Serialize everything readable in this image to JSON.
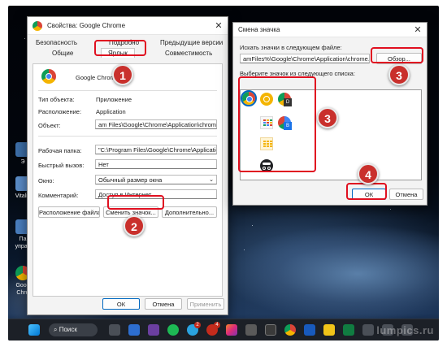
{
  "desktop": {
    "items": [
      {
        "label": "Э"
      },
      {
        "label": "Vitaliy"
      },
      {
        "label": "Па\nуправ"
      },
      {
        "label": "Goog\nChro"
      }
    ]
  },
  "properties": {
    "title": "Свойства: Google Chrome",
    "tabs_row1": [
      "Безопасность",
      "Подробно",
      "Предыдущие версии"
    ],
    "tabs_row2": [
      "Общие",
      "Ярлык",
      "Совместимость"
    ],
    "app_name": "Google Chrome",
    "fields": {
      "type_label": "Тип объекта:",
      "type_value": "Приложение",
      "location_label": "Расположение:",
      "location_value": "Application",
      "target_label": "Объект:",
      "target_value": "am Files\\Google\\Chrome\\Application\\chrome.exe\"",
      "workdir_label": "Рабочая папка:",
      "workdir_value": "\"C:\\Program Files\\Google\\Chrome\\Application\"",
      "hotkey_label": "Быстрый вызов:",
      "hotkey_value": "Нет",
      "window_label": "Окно:",
      "window_value": "Обычный размер окна",
      "comment_label": "Комментарий:",
      "comment_value": "Доступ в Интернет"
    },
    "buttons": {
      "open_location": "Расположение файла",
      "change_icon": "Сменить значок...",
      "advanced": "Дополнительно...",
      "ok": "ОК",
      "cancel": "Отмена",
      "apply": "Применить"
    }
  },
  "icon_dialog": {
    "title": "Смена значка",
    "search_label": "Искать значки в следующем файле:",
    "path_value": "amFiles%\\Google\\Chrome\\Application\\chrome.exe",
    "browse": "Обзор...",
    "list_label": "Выберите значок из следующего списка:",
    "ok": "ОК",
    "cancel": "Отмена"
  },
  "badges": [
    "1",
    "2",
    "3",
    "3",
    "4"
  ],
  "taskbar": {
    "search": "Поиск",
    "badge_a": "2",
    "badge_b": "4"
  },
  "watermark": "lumpics.ru",
  "colors": {
    "highlight": "#e01020",
    "badge_bg": "#c9302c",
    "accent": "#0067c0",
    "chrome_red": "#db4437",
    "chrome_yellow": "#f4b400",
    "chrome_green": "#0f9d58",
    "chrome_blue": "#4285f4"
  }
}
